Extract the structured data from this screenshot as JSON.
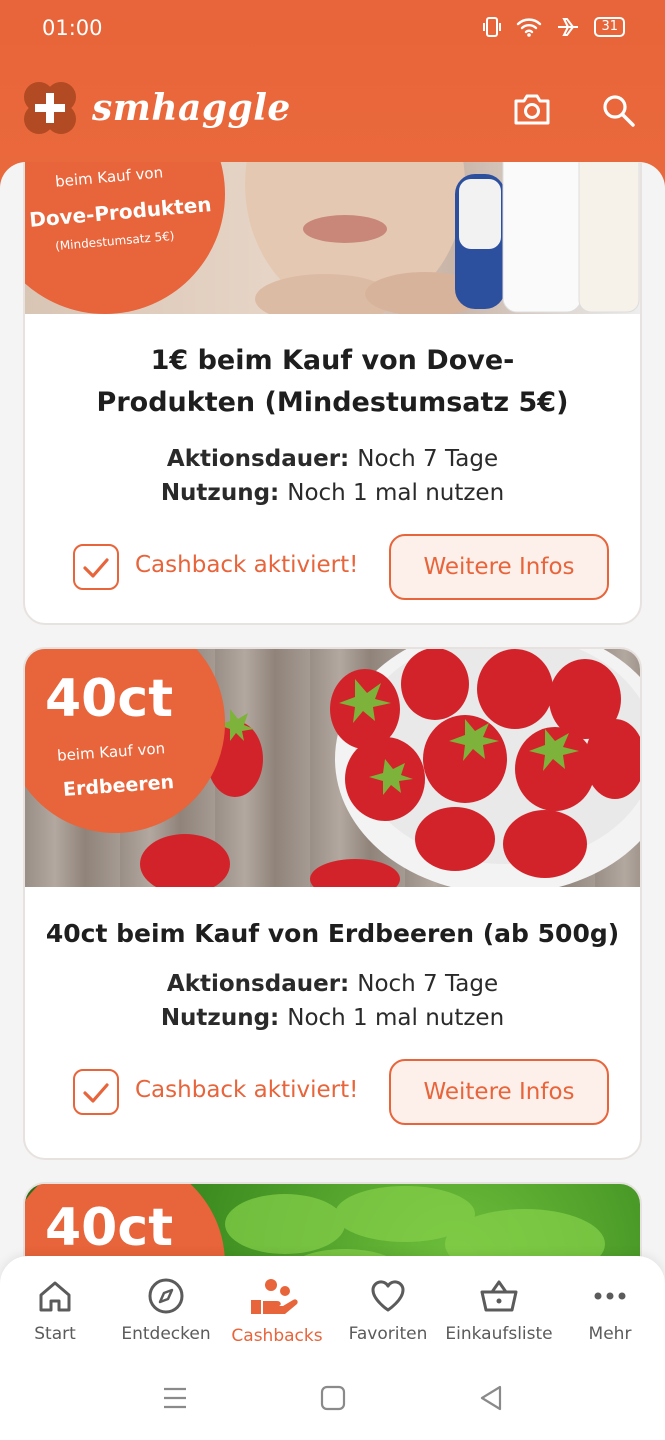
{
  "status": {
    "time": "01:00",
    "battery": "31"
  },
  "app": {
    "name": "smhaggle"
  },
  "cards": [
    {
      "badge_line1": "beim Kauf von",
      "badge_line2": "Dove-Produkten",
      "badge_line3": "(Mindestumsatz 5€)",
      "title": "1€ beim Kauf von Dove-Produkten (Mindestumsatz 5€)",
      "duration_label": "Aktionsdauer:",
      "duration_value": "Noch 7 Tage",
      "usage_label": "Nutzung:",
      "usage_value": "Noch 1 mal nutzen",
      "cashback_label": "Cashback aktiviert!",
      "info_button": "Weitere Infos"
    },
    {
      "badge_big": "40ct",
      "badge_line1": "beim Kauf von",
      "badge_line2": "Erdbeeren",
      "title": "40ct beim Kauf von Erdbeeren (ab 500g)",
      "duration_label": "Aktionsdauer:",
      "duration_value": "Noch 7 Tage",
      "usage_label": "Nutzung:",
      "usage_value": "Noch 1 mal nutzen",
      "cashback_label": "Cashback aktiviert!",
      "info_button": "Weitere Infos"
    },
    {
      "badge_big": "40ct"
    }
  ],
  "nav": [
    {
      "label": "Start",
      "icon": "home-icon"
    },
    {
      "label": "Entdecken",
      "icon": "compass-icon"
    },
    {
      "label": "Cashbacks",
      "icon": "cashback-hand-icon",
      "active": true
    },
    {
      "label": "Favoriten",
      "icon": "heart-icon"
    },
    {
      "label": "Einkaufsliste",
      "icon": "basket-icon"
    },
    {
      "label": "Mehr",
      "icon": "more-icon"
    }
  ],
  "colors": {
    "accent": "#e8643a",
    "background": "#f5f4f4"
  }
}
